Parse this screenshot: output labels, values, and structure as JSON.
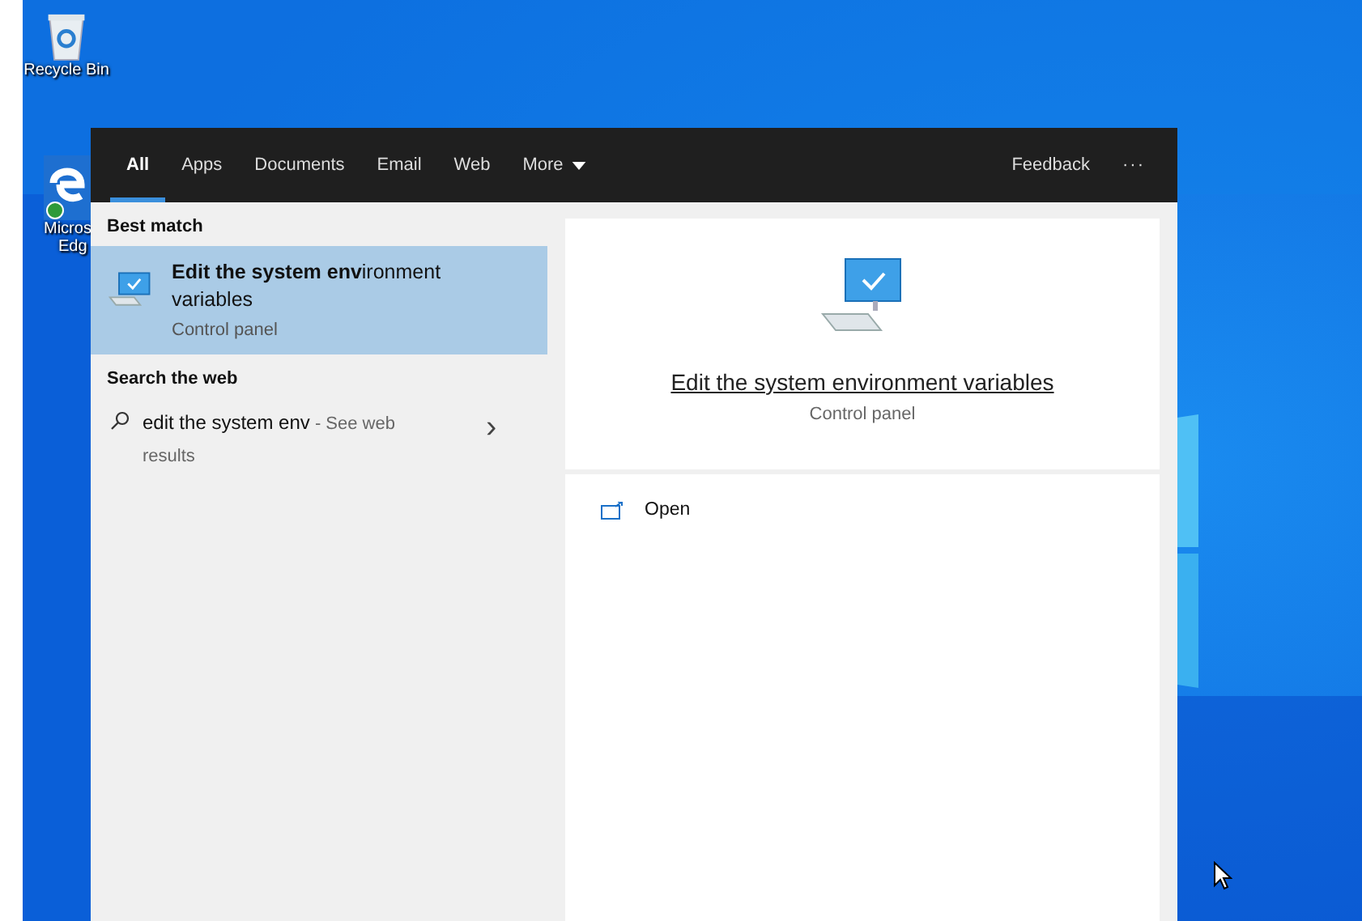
{
  "desktop_icons": [
    {
      "kind": "recycle",
      "label_lines": [
        "Recycle Bin"
      ]
    },
    {
      "kind": "browser",
      "label_lines": [
        "Micros",
        "Edg"
      ]
    }
  ],
  "tabs": [
    {
      "label": "All",
      "selected": true
    },
    {
      "label": "Apps",
      "selected": false
    },
    {
      "label": "Documents",
      "selected": false
    },
    {
      "label": "Email",
      "selected": false
    },
    {
      "label": "Web",
      "selected": false
    },
    {
      "label": "More",
      "selected": false,
      "dropdown": true
    }
  ],
  "header_actions": {
    "feedback": "Feedback",
    "more": "···"
  },
  "best_match": {
    "heading": "Best match",
    "title": "**Edit the system env**ironment variables",
    "subtitle": "Control panel",
    "selected": true
  },
  "web_search": {
    "heading": "Search the web",
    "query": "edit the system env",
    "suffix": " - See web results",
    "chevron": "›"
  },
  "preview": {
    "title": "Edit the system environment variables",
    "subtitle": "Control panel",
    "actions": [
      {
        "label": "Open"
      }
    ]
  }
}
